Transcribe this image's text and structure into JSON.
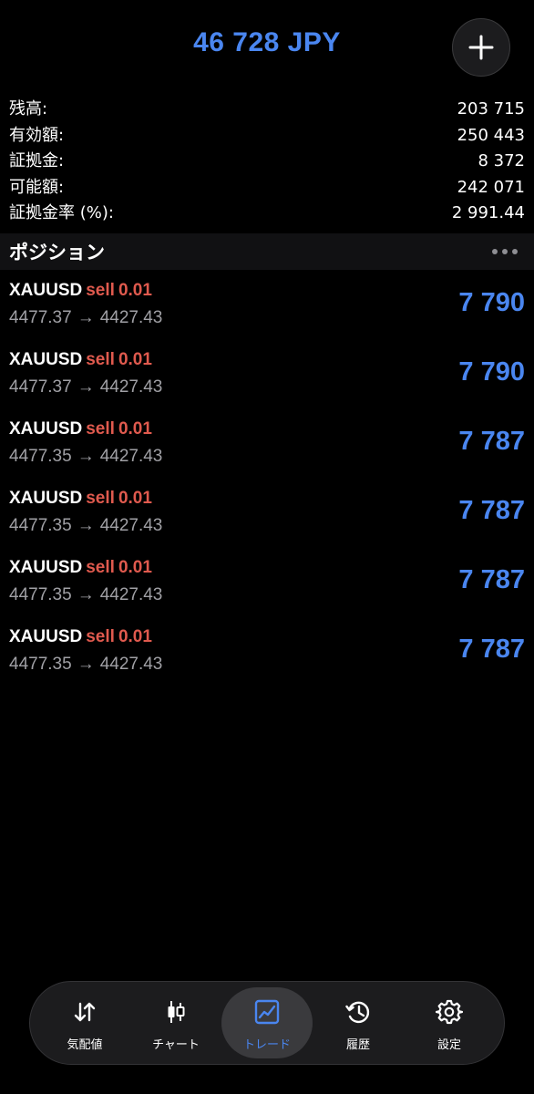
{
  "header": {
    "balance_title": "46 728 JPY",
    "add_label": "+"
  },
  "summary": [
    {
      "label": "残高:",
      "value": "203 715"
    },
    {
      "label": "有効額:",
      "value": "250 443"
    },
    {
      "label": "証拠金:",
      "value": "8 372"
    },
    {
      "label": "可能額:",
      "value": "242 071"
    },
    {
      "label": "証拠金率 (%):",
      "value": "2 991.44"
    }
  ],
  "positions_section": {
    "title": "ポジション"
  },
  "positions": [
    {
      "symbol": "XAUUSD",
      "side": "sell",
      "volume": "0.01",
      "open_price": "4477.37",
      "arrow": "→",
      "current_price": "4427.43",
      "profit": "7 790"
    },
    {
      "symbol": "XAUUSD",
      "side": "sell",
      "volume": "0.01",
      "open_price": "4477.37",
      "arrow": "→",
      "current_price": "4427.43",
      "profit": "7 790"
    },
    {
      "symbol": "XAUUSD",
      "side": "sell",
      "volume": "0.01",
      "open_price": "4477.35",
      "arrow": "→",
      "current_price": "4427.43",
      "profit": "7 787"
    },
    {
      "symbol": "XAUUSD",
      "side": "sell",
      "volume": "0.01",
      "open_price": "4477.35",
      "arrow": "→",
      "current_price": "4427.43",
      "profit": "7 787"
    },
    {
      "symbol": "XAUUSD",
      "side": "sell",
      "volume": "0.01",
      "open_price": "4477.35",
      "arrow": "→",
      "current_price": "4427.43",
      "profit": "7 787"
    },
    {
      "symbol": "XAUUSD",
      "side": "sell",
      "volume": "0.01",
      "open_price": "4477.35",
      "arrow": "→",
      "current_price": "4427.43",
      "profit": "7 787"
    }
  ],
  "tabbar": {
    "active_tab": "trade",
    "tabs": [
      {
        "id": "quotes",
        "label": "気配値",
        "icon": "sort-arrows-icon"
      },
      {
        "id": "chart",
        "label": "チャート",
        "icon": "candlestick-icon"
      },
      {
        "id": "trade",
        "label": "トレード",
        "icon": "trend-chart-icon"
      },
      {
        "id": "history",
        "label": "履歴",
        "icon": "history-clock-icon"
      },
      {
        "id": "settings",
        "label": "設定",
        "icon": "gear-icon"
      }
    ]
  },
  "colors": {
    "accent": "#4a86f0",
    "sell": "#e05a4e",
    "background": "#000000",
    "secondary_text": "#a0a0a5"
  }
}
